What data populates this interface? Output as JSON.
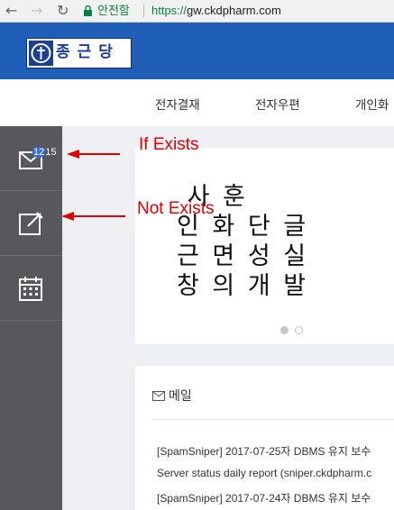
{
  "browser": {
    "back_icon": "←",
    "forward_icon": "→",
    "reload_icon": "↻",
    "security_label": "안전함",
    "url_scheme": "https://",
    "url_host": "gw.ckdpharm.com"
  },
  "header": {
    "logo_text": "종근당",
    "brand_color": "#1f5fb8"
  },
  "topnav": {
    "tabs": [
      "전자결재",
      "전자우편",
      "개인화"
    ]
  },
  "sidebar": {
    "mail_badge": "12",
    "mail_badge_overflow": "15"
  },
  "banner": {
    "text": " 사 훈\n인 화 단 글\n근 면 성 실\n창 의 개 발"
  },
  "mail_panel": {
    "title": "메일",
    "rows": [
      "[SpamSniper] 2017-07-25자 DBMS 유지 보수",
      "Server status daily report (sniper.ckdpharm.c",
      "[SpamSniper] 2017-07-24자 DBMS 유지 보수"
    ]
  },
  "annotations": {
    "if_exists": "If Exists",
    "not_exists": "Not Exists",
    "arrow_color": "#e00000"
  }
}
